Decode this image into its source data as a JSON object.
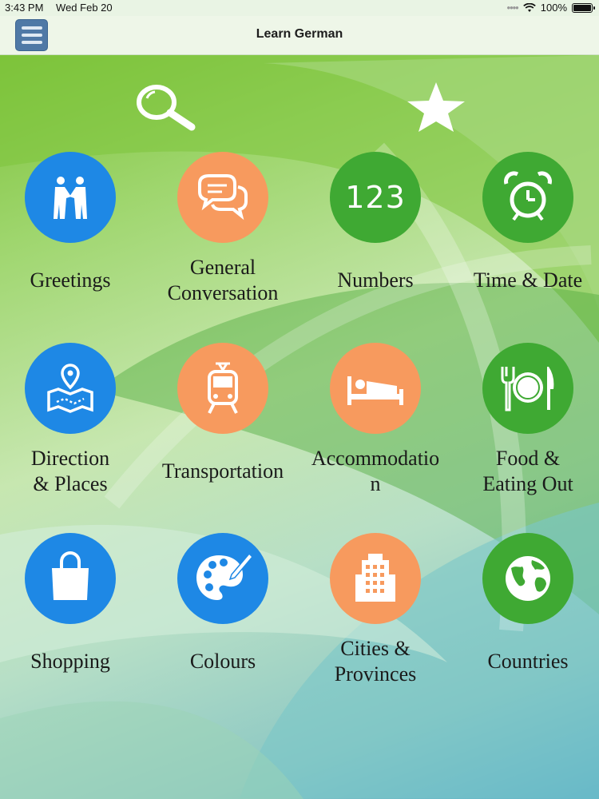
{
  "status": {
    "time": "3:43 PM",
    "date": "Wed Feb 20",
    "battery": "100%",
    "battery_level": 1.0
  },
  "navbar": {
    "title": "Learn German"
  },
  "tools": {
    "search_icon": "search-icon",
    "favorite_icon": "star-icon"
  },
  "colors": {
    "blue": "#1e88e5",
    "orange": "#f79a5e",
    "green": "#3fa933"
  },
  "categories": [
    {
      "label": "Greetings",
      "icon": "handshake-icon",
      "color": "blue"
    },
    {
      "label": "General Conversation",
      "icon": "chat-bubbles-icon",
      "color": "orange"
    },
    {
      "label": "Numbers",
      "icon": "numbers-icon",
      "glyph": "123",
      "color": "green"
    },
    {
      "label": "Time & Date",
      "icon": "alarm-clock-icon",
      "color": "green"
    },
    {
      "label": "Direction & Places",
      "icon": "map-pin-icon",
      "color": "blue"
    },
    {
      "label": "Transportation",
      "icon": "tram-icon",
      "color": "orange"
    },
    {
      "label": "Accommodation",
      "icon": "bed-icon",
      "color": "orange"
    },
    {
      "label": "Food & Eating Out",
      "icon": "plate-cutlery-icon",
      "color": "green"
    },
    {
      "label": "Shopping",
      "icon": "shopping-bag-icon",
      "color": "blue"
    },
    {
      "label": "Colours",
      "icon": "palette-icon",
      "color": "blue"
    },
    {
      "label": "Cities & Provinces",
      "icon": "building-icon",
      "color": "orange"
    },
    {
      "label": "Countries",
      "icon": "globe-icon",
      "color": "green"
    }
  ]
}
